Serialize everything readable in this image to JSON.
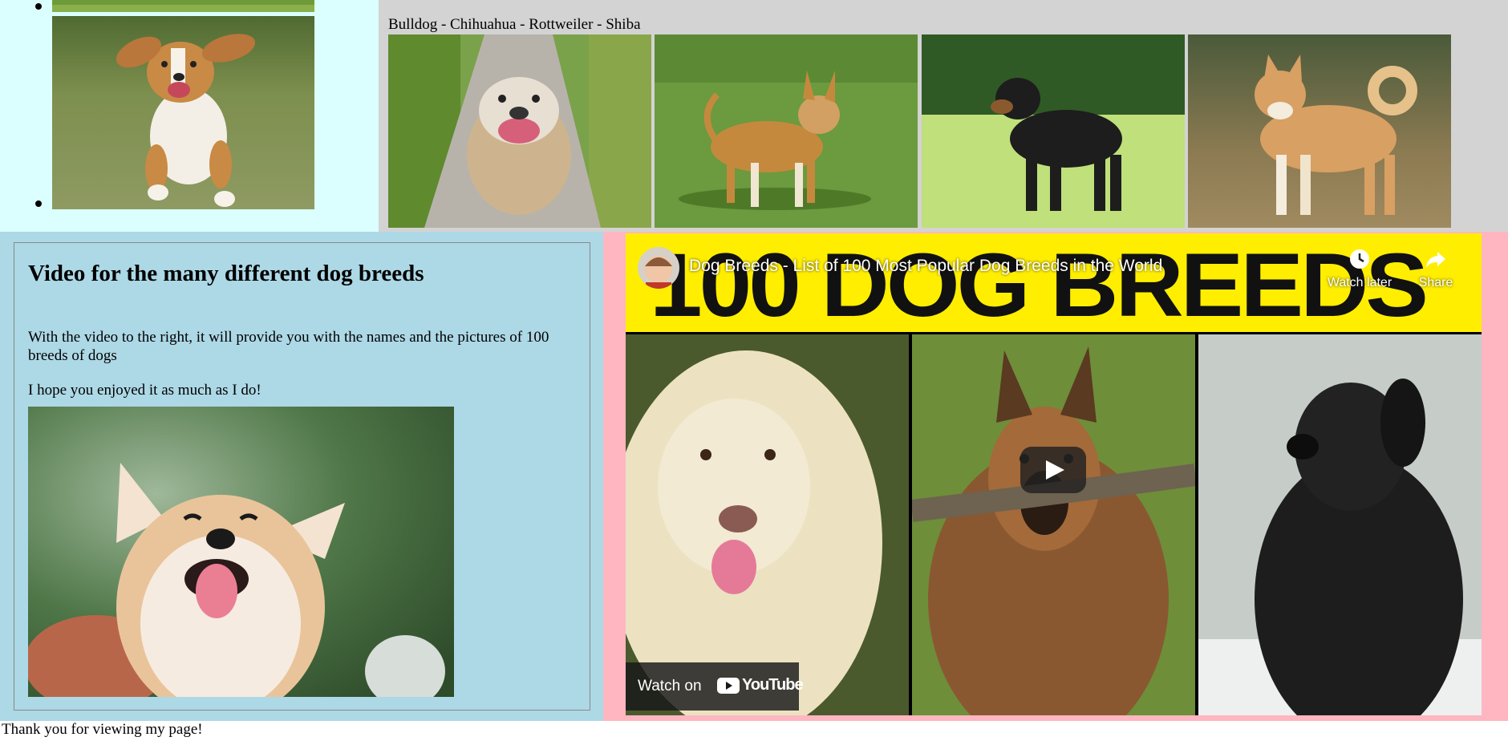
{
  "top_left": {
    "bullets": 2
  },
  "gallery": {
    "caption": "Bulldog - Chihuahua - Rottweiler - Shiba",
    "images": [
      "Bulldog",
      "Chihuahua",
      "Rottweiler",
      "Shiba"
    ]
  },
  "article": {
    "heading": "Video for the many different dog breeds",
    "paragraph_1": "With the video to the right, it will provide you with the names and the pictures of 100 breeds of dogs",
    "paragraph_2": "I hope you enjoyed it as much as I do!"
  },
  "video": {
    "banner_text": "100 DOG BREEDS",
    "title": "Dog Breeds - List of 100 Most Popular Dog Breeds in the World",
    "watch_later_label": "Watch later",
    "share_label": "Share",
    "watch_on_label": "Watch on",
    "youtube_logo_text": "YouTube",
    "colors": {
      "banner": "#ffee00",
      "youtube_red": "#ff0000"
    }
  },
  "footer": {
    "text": "Thank you for viewing my page!"
  },
  "colors": {
    "top_left_bg": "#dbffff",
    "top_right_bg": "#d3d3d3",
    "bottom_left_bg": "#add8e6",
    "bottom_right_bg": "#ffb6c1"
  }
}
